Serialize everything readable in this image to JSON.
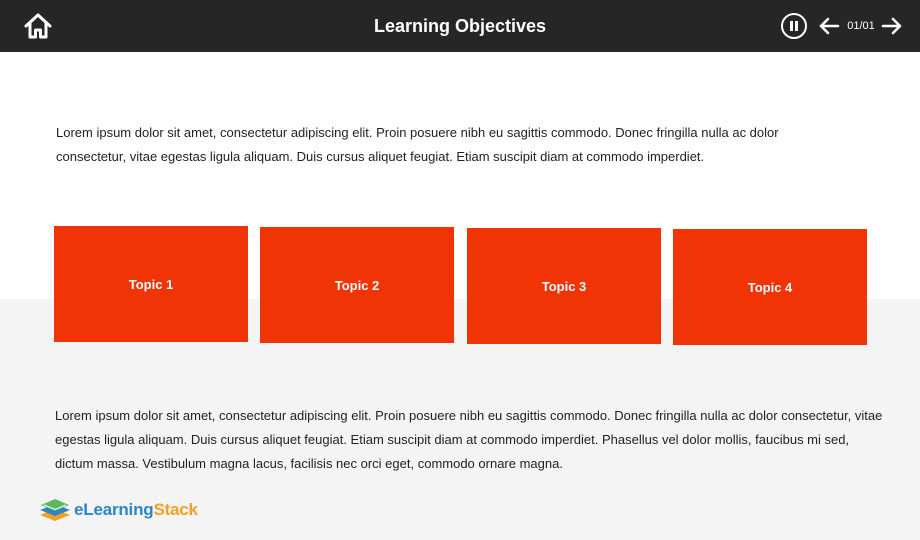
{
  "header": {
    "title": "Learning Objectives",
    "page_counter": "01/01",
    "background": "#262626"
  },
  "icons": {
    "home": "home-icon",
    "pause": "pause-icon",
    "prev": "arrow-left-icon",
    "next": "arrow-right-icon"
  },
  "intro_text": "Lorem ipsum dolor sit amet, consectetur adipiscing elit. Proin posuere nibh eu sagittis commodo. Donec fringilla nulla ac dolor consectetur, vitae egestas ligula aliquam. Duis cursus aliquet feugiat. Etiam suscipit diam at commodo imperdiet.",
  "topics": [
    {
      "label": "Topic 1"
    },
    {
      "label": "Topic 2"
    },
    {
      "label": "Topic 3"
    },
    {
      "label": "Topic 4"
    }
  ],
  "topic_color": "#f03406",
  "body_text": "Lorem ipsum dolor sit amet, consectetur adipiscing elit. Proin posuere nibh eu sagittis commodo. Donec fringilla nulla ac dolor consectetur, vitae egestas ligula aliquam. Duis cursus aliquet feugiat. Etiam suscipit diam at commodo imperdiet. Phasellus vel dolor mollis, faucibus mi sed, dictum massa. Vestibulum magna lacus, facilisis nec orci eget, commodo ornare magna.",
  "logo": {
    "part1": "eLearning",
    "part2": "Stack",
    "colors": {
      "primary": "#2a86c9",
      "secondary": "#f5a11f"
    }
  }
}
